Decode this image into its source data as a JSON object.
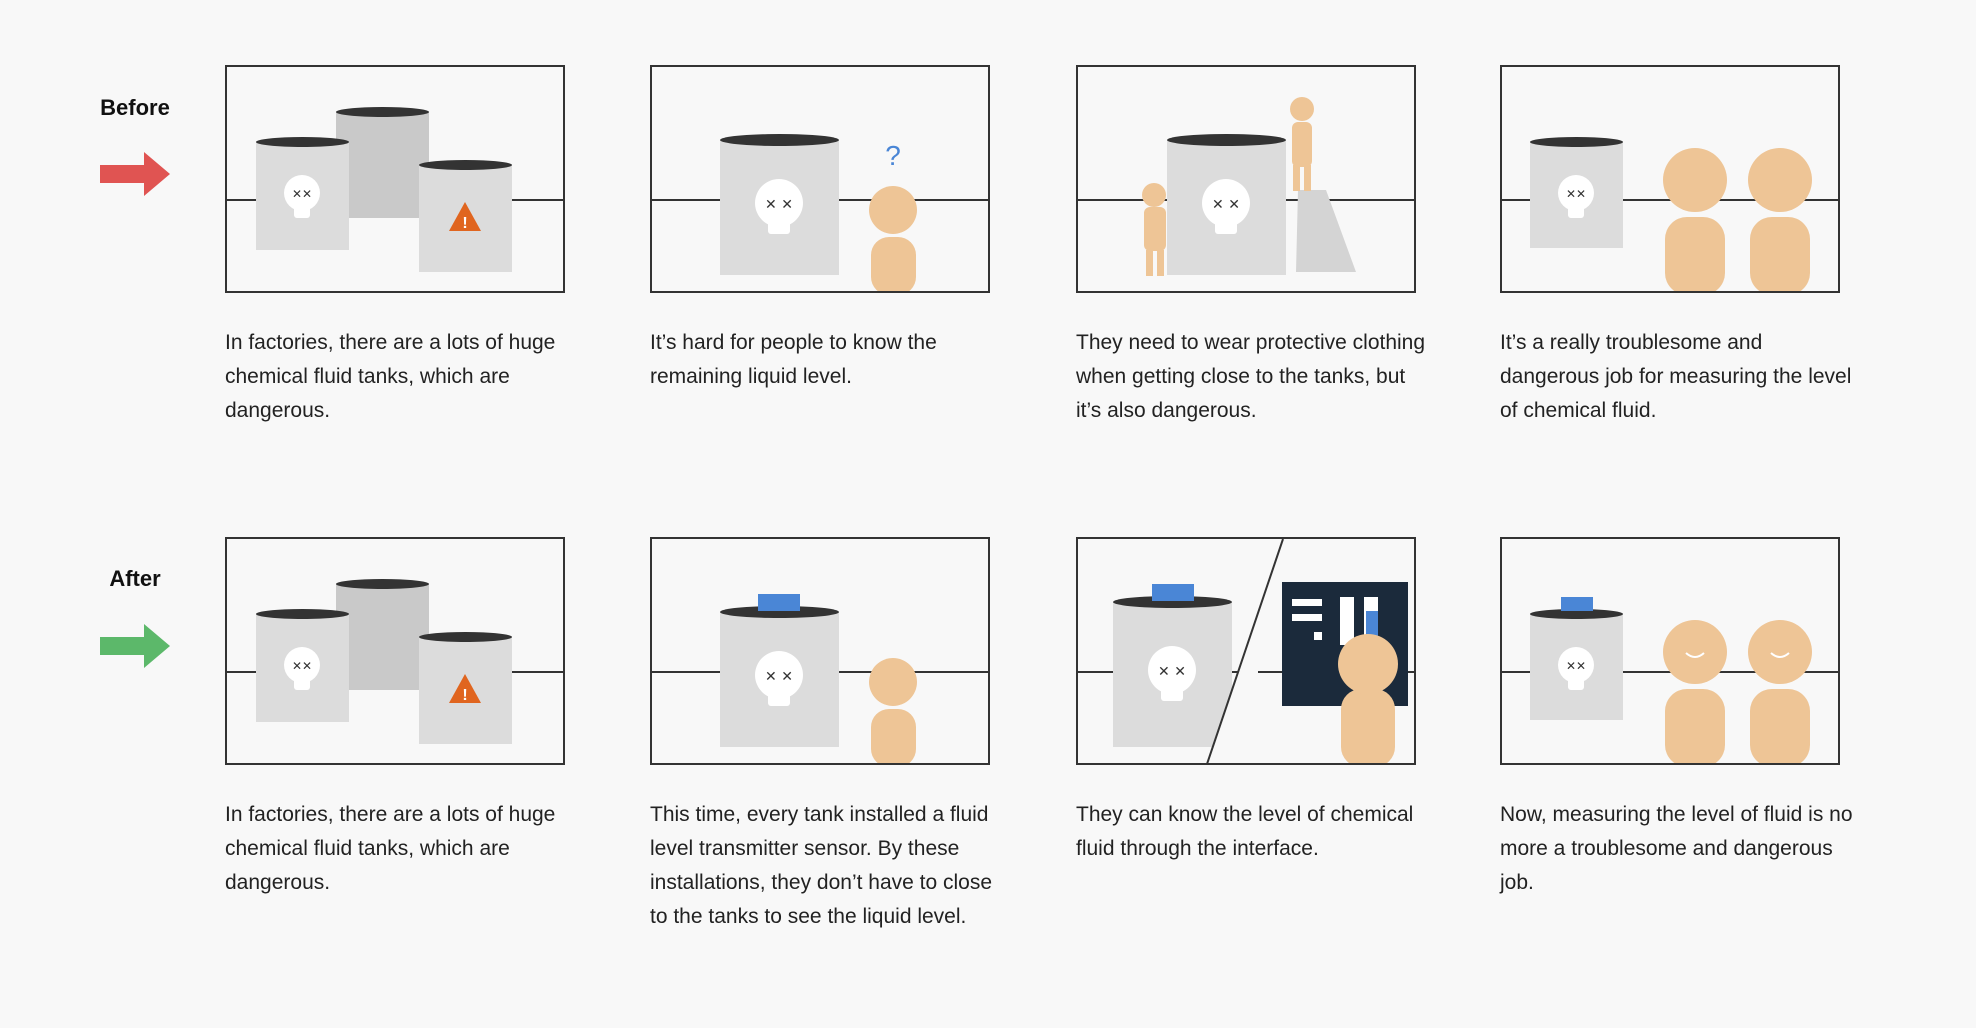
{
  "rows": [
    {
      "label": "Before",
      "arrow_color": "#e05452",
      "captions": [
        "In factories, there are a lots of huge chemical fluid tanks, which are dangerous.",
        "It’s hard for people to know the remaining liquid level.",
        "They need to wear protective clothing when getting close to the tanks, but it’s also dangerous.",
        "It’s a really troublesome and dangerous job for measuring the level of chemical fluid."
      ]
    },
    {
      "label": "After",
      "arrow_color": "#5cb86a",
      "captions": [
        "In factories, there are a lots of huge chemical fluid tanks, which are dangerous.",
        "This time, every tank installed a fluid level transmitter sensor. By these installations, they don’t have to close to the tanks to see the liquid level.",
        "They can know the level of chemical fluid through the interface.",
        "Now, measuring the level of fluid is no more a troublesome and dangerous job."
      ]
    }
  ],
  "glyphs": {
    "question": "?",
    "warning": "!"
  },
  "colors": {
    "tank": "#dcdcdc",
    "tank_back": "#c9c9c9",
    "tank_top": "#333333",
    "skin": "#eec596",
    "warning": "#e0651f",
    "sensor": "#4a86d6",
    "screen": "#1b2a3b",
    "question": "#4a86d6"
  }
}
